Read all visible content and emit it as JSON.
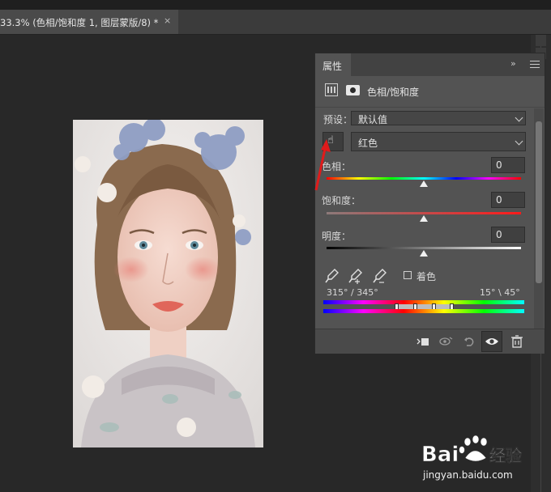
{
  "document": {
    "tab_title": "33.3% (色相/饱和度 1, 图层蒙版/8) *",
    "close_glyph": "×"
  },
  "properties_panel": {
    "tab_label": "属性",
    "collapse_glyph": "»",
    "adjustment_title": "色相/饱和度",
    "preset": {
      "label": "预设：",
      "value": "默认值"
    },
    "channel": {
      "value": "红色"
    },
    "targeted_adjust_glyph": "☝",
    "hue": {
      "label": "色相：",
      "value": "0",
      "fraction": 0.5
    },
    "saturation": {
      "label": "饱和度：",
      "value": "0",
      "fraction": 0.5
    },
    "lightness": {
      "label": "明度：",
      "value": "0",
      "fraction": 0.5
    },
    "colorize": {
      "label": "着色",
      "checked": false
    },
    "range_left": "315° / 345°",
    "range_right": "15° \\ 45°",
    "footer_icons": [
      "clip-to-layer-icon",
      "view-previous-icon",
      "reset-icon",
      "visibility-eye-icon",
      "trash-icon"
    ]
  },
  "watermark": {
    "brand": "Bai",
    "brand_cn": "经验",
    "url": "jingyan.baidu.com"
  },
  "colors": {
    "panel_bg": "#535353",
    "workspace_bg": "#282828",
    "annotation_arrow": "#e01b1b"
  }
}
